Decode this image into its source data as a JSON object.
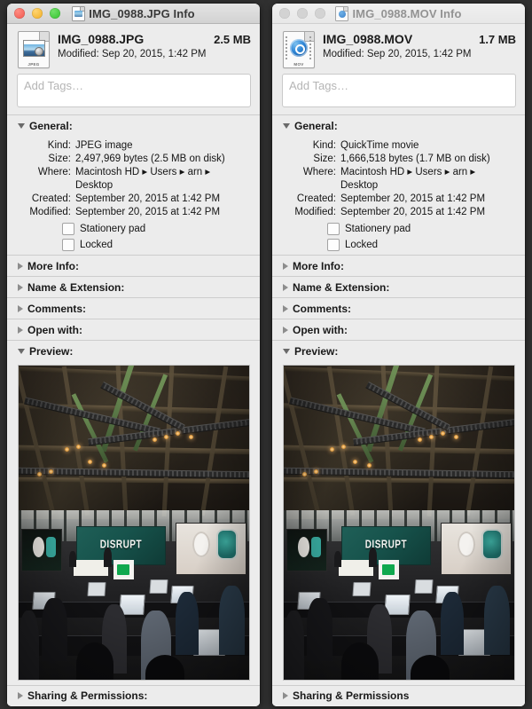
{
  "desktop": {
    "background_color": "#313131"
  },
  "windows": [
    {
      "id": "jpg",
      "active": true,
      "title": "IMG_0988.JPG Info",
      "title_icon": "jpeg-document-icon",
      "traffic_lights": {
        "close": "close-button",
        "minimize": "minimize-button",
        "zoom": "zoom-button"
      },
      "file": {
        "icon": "jpeg-file-icon",
        "icon_kind_tag": "JPEG",
        "name": "IMG_0988.JPG",
        "size": "2.5 MB",
        "modified": "Modified: Sep 20, 2015, 1:42 PM"
      },
      "tags": {
        "placeholder": "Add Tags…",
        "value": ""
      },
      "general": {
        "title": "General:",
        "expanded": true,
        "rows": [
          {
            "label": "Kind:",
            "value": "JPEG image"
          },
          {
            "label": "Size:",
            "value": "2,497,969 bytes (2.5 MB on disk)"
          },
          {
            "label": "Where:",
            "value": "Macintosh HD ▸ Users ▸ arn ▸",
            "cont": "Desktop"
          },
          {
            "label": "Created:",
            "value": "September 20, 2015 at 1:42 PM"
          },
          {
            "label": "Modified:",
            "value": "September 20, 2015 at 1:42 PM"
          }
        ],
        "checkboxes": [
          {
            "label": "Stationery pad",
            "checked": false
          },
          {
            "label": "Locked",
            "checked": false
          }
        ]
      },
      "sections": [
        {
          "title": "More Info:",
          "expanded": false
        },
        {
          "title": "Name & Extension:",
          "expanded": false
        },
        {
          "title": "Comments:",
          "expanded": false
        },
        {
          "title": "Open with:",
          "expanded": false
        }
      ],
      "preview": {
        "title": "Preview:",
        "expanded": true
      },
      "footer": {
        "title": "Sharing & Permissions:",
        "expanded": false
      }
    },
    {
      "id": "mov",
      "active": false,
      "title": "IMG_0988.MOV Info",
      "title_icon": "quicktime-document-icon",
      "traffic_lights": {
        "close": "close-button",
        "minimize": "minimize-button",
        "zoom": "zoom-button"
      },
      "file": {
        "icon": "quicktime-file-icon",
        "icon_kind_tag": "MOV",
        "name": "IMG_0988.MOV",
        "size": "1.7 MB",
        "modified": "Modified: Sep 20, 2015, 1:42 PM"
      },
      "tags": {
        "placeholder": "Add Tags…",
        "value": ""
      },
      "general": {
        "title": "General:",
        "expanded": true,
        "rows": [
          {
            "label": "Kind:",
            "value": "QuickTime movie"
          },
          {
            "label": "Size:",
            "value": "1,666,518 bytes (1.7 MB on disk)"
          },
          {
            "label": "Where:",
            "value": "Macintosh HD ▸ Users ▸ arn ▸",
            "cont": "Desktop"
          },
          {
            "label": "Created:",
            "value": "September 20, 2015 at 1:42 PM"
          },
          {
            "label": "Modified:",
            "value": "September 20, 2015 at 1:42 PM"
          }
        ],
        "checkboxes": [
          {
            "label": "Stationery pad",
            "checked": false
          },
          {
            "label": "Locked",
            "checked": false
          }
        ]
      },
      "sections": [
        {
          "title": "More Info:",
          "expanded": false
        },
        {
          "title": "Name & Extension:",
          "expanded": false
        },
        {
          "title": "Comments:",
          "expanded": false
        },
        {
          "title": "Open with:",
          "expanded": false
        }
      ],
      "preview": {
        "title": "Preview:",
        "expanded": true
      },
      "footer": {
        "title": "Sharing & Permissions",
        "expanded": false
      }
    }
  ],
  "preview_scene": {
    "description": "Conference hall interior with industrial wood truss ceiling, stage lighting rigs, audience with laptops",
    "stage_banner_text": "DISRUPT",
    "stage_banner_color": "#1f5f57",
    "podium_logo_color": "#0fa84e",
    "screen_subject": "smartwatch held in hand"
  }
}
